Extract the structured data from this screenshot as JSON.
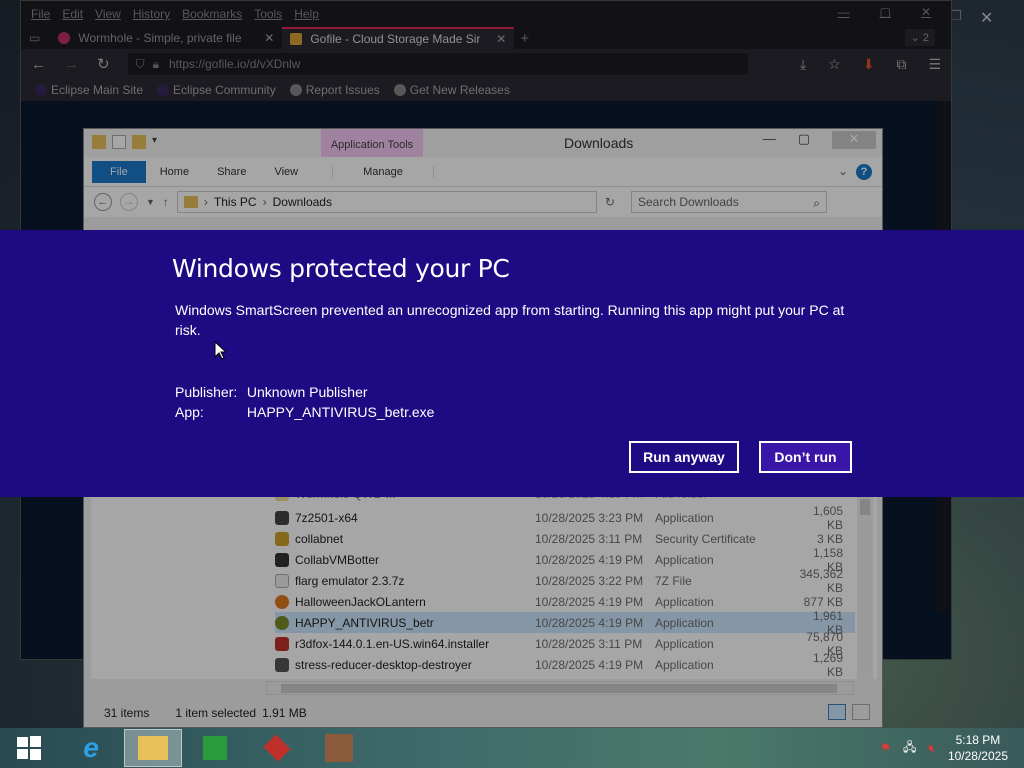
{
  "desktop": {
    "close": "✕",
    "restore": "❐"
  },
  "browser": {
    "menu": [
      "File",
      "Edit",
      "View",
      "History",
      "Bookmarks",
      "Tools",
      "Help"
    ],
    "win_ctrls": [
      "—",
      "▢",
      "✕"
    ],
    "tabs": [
      {
        "title": "Wormhole - Simple, private file",
        "close": "✕"
      },
      {
        "title": "Gofile - Cloud Storage Made Sir",
        "close": "✕"
      }
    ],
    "new_tab": "+",
    "tab_count": "⌄ 2",
    "url": "https://gofile.io/d/vXDnlw",
    "bookmarks": [
      "Eclipse Main Site",
      "Eclipse Community",
      "Report Issues",
      "Get New Releases"
    ]
  },
  "explorer": {
    "caption": "Downloads",
    "app_tools": "Application Tools",
    "ribbon_tabs": [
      "File",
      "Home",
      "Share",
      "View",
      "Manage"
    ],
    "help": "?",
    "path": [
      "This PC",
      "Downloads"
    ],
    "search_placeholder": "Search Downloads",
    "files": [
      {
        "name": "Wormhole QWD ...",
        "date": "10/28/2025 4:19 PM",
        "type": "File folder",
        "size": ""
      },
      {
        "name": "7z2501-x64",
        "date": "10/28/2025 3:23 PM",
        "type": "Application",
        "size": "1,605 KB",
        "color": "#444"
      },
      {
        "name": "collabnet",
        "date": "10/28/2025 3:11 PM",
        "type": "Security Certificate",
        "size": "3 KB",
        "color": "#c9a227"
      },
      {
        "name": "CollabVMBotter",
        "date": "10/28/2025 4:19 PM",
        "type": "Application",
        "size": "1,158 KB",
        "color": "#333"
      },
      {
        "name": "flarg emulator 2.3.7z",
        "date": "10/28/2025 3:22 PM",
        "type": "7Z File",
        "size": "345,362 KB",
        "color": "#ddd"
      },
      {
        "name": "HalloweenJackOLantern",
        "date": "10/28/2025 4:19 PM",
        "type": "Application",
        "size": "877 KB",
        "color": "#e07a1f"
      },
      {
        "name": "HAPPY_ANTIVIRUS_betr",
        "date": "10/28/2025 4:19 PM",
        "type": "Application",
        "size": "1,961 KB",
        "color": "#7a8a2a"
      },
      {
        "name": "r3dfox-144.0.1.en-US.win64.installer",
        "date": "10/28/2025 3:11 PM",
        "type": "Application",
        "size": "75,870 KB",
        "color": "#c0302a"
      },
      {
        "name": "stress-reducer-desktop-destroyer",
        "date": "10/28/2025 4:19 PM",
        "type": "Application",
        "size": "1,269 KB",
        "color": "#555"
      }
    ],
    "status": {
      "items": "31 items",
      "selected": "1 item selected",
      "size": "1.91 MB"
    }
  },
  "smartscreen": {
    "title": "Windows protected your PC",
    "body": "Windows SmartScreen prevented an unrecognized app from starting. Running this app might put your PC at risk.",
    "publisher_key": "Publisher:",
    "publisher_val": "Unknown Publisher",
    "app_key": "App:",
    "app_val": "HAPPY_ANTIVIRUS_betr.exe",
    "run_anyway": "Run anyway",
    "dont_run": "Don’t run"
  },
  "taskbar": {
    "time": "5:18 PM",
    "date": "10/28/2025"
  }
}
